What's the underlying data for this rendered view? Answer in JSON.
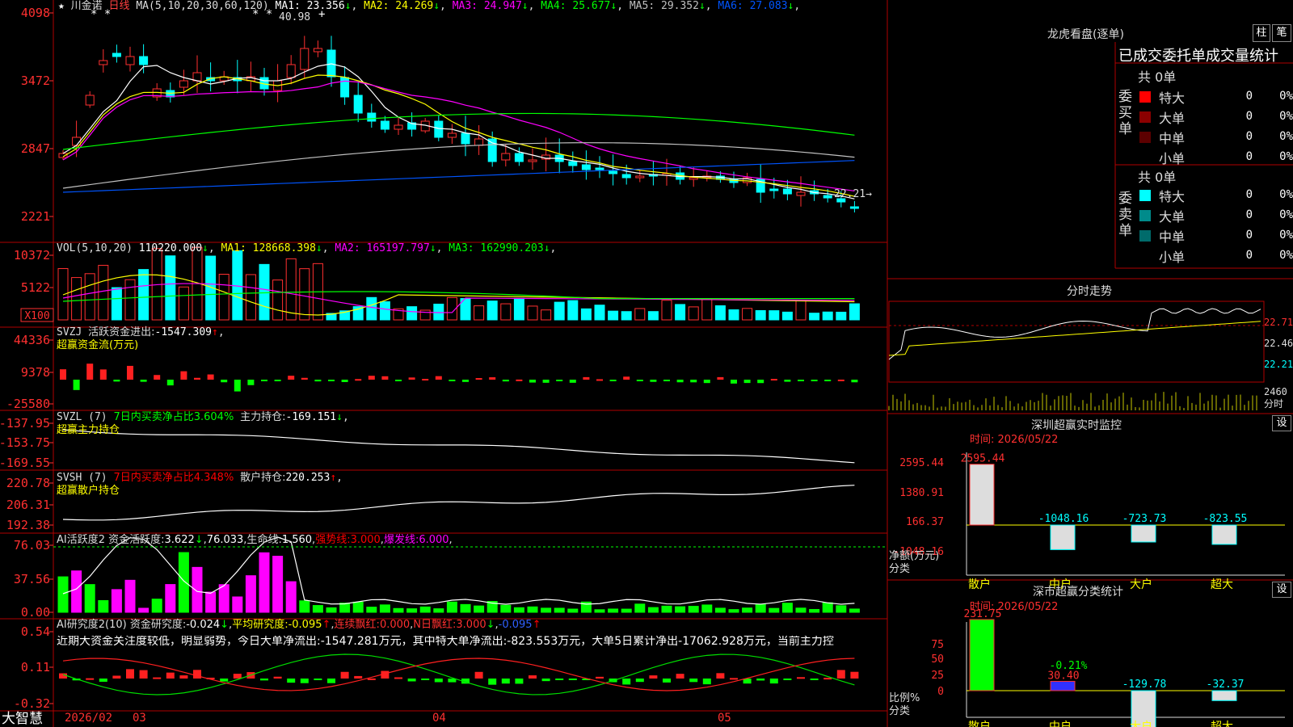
{
  "stock": {
    "name": "川金诺",
    "period": "日线",
    "ma_label": "MA(5,10,20,30,60,120)",
    "ma": [
      {
        "label": "MA1:",
        "value": "23.356",
        "arrow": "↓",
        "color": "#ffffff"
      },
      {
        "label": "MA2:",
        "value": "24.269",
        "arrow": "↓",
        "color": "#ffff00"
      },
      {
        "label": "MA3:",
        "value": "24.947",
        "arrow": "↓",
        "color": "#ff00ff"
      },
      {
        "label": "MA4:",
        "value": "25.677",
        "arrow": "↓",
        "color": "#00ff00"
      },
      {
        "label": "MA5:",
        "value": "29.352",
        "arrow": "↓",
        "color": "#c0c0c0"
      },
      {
        "label": "MA6:",
        "value": "27.083",
        "arrow": "↓",
        "color": "#0055ff"
      }
    ],
    "high_label": "40.98",
    "low_label": "22.21",
    "y_ticks": [
      "4098",
      "3472",
      "2847",
      "2221"
    ]
  },
  "vol": {
    "title": "VOL(5,10,20)",
    "value": "110220.000",
    "arrow": "↓",
    "ma": [
      {
        "label": "MA1:",
        "value": "128668.398",
        "arrow": "↓",
        "color": "#ffff00"
      },
      {
        "label": "MA2:",
        "value": "165197.797",
        "arrow": "↓",
        "color": "#ff00ff"
      },
      {
        "label": "MA3:",
        "value": "162990.203",
        "arrow": "↓",
        "color": "#00ff00"
      }
    ],
    "y_ticks": [
      "10372",
      "5122"
    ],
    "unit": "X100"
  },
  "svzj": {
    "title": "SVZJ",
    "label": "活跃资金进出:",
    "value": "-1547.309",
    "arrow": "↑",
    "comma": ",",
    "sub": "超赢资金流(万元)",
    "y_ticks": [
      "44336",
      "9378",
      "-25580"
    ]
  },
  "svzl": {
    "title": "SVZL (7)",
    "ratio": "7日内买卖净占比3.604%",
    "label": "主力持仓:",
    "value": "-169.151",
    "arrow": "↓",
    "comma": ",",
    "sub": "超赢主力持仓",
    "y_ticks": [
      "-137.95",
      "-153.75",
      "-169.55"
    ]
  },
  "svsh": {
    "title": "SVSH (7)",
    "ratio": "7日内买卖净占比4.348%",
    "label": "散户持仓:",
    "value": "220.253",
    "arrow": "↑",
    "comma": ",",
    "sub": "超赢散户持仓",
    "y_ticks": [
      "220.78",
      "206.31",
      "192.38"
    ]
  },
  "ai1": {
    "title": "AI活跃度2",
    "label": "资金活跃度:",
    "value": "3.622",
    "arrow": "↓",
    "comma": ",",
    "v2": "76.033",
    "lbl3": "生命线:",
    "v3": "1.560",
    "comma2": ",",
    "lbl4": "强势线:",
    "v4": "3.000",
    "lbl5": "爆发线:",
    "v5": "6.000",
    "y_ticks": [
      "76.03",
      "37.56",
      "0.00"
    ]
  },
  "ai2": {
    "title": "AI研究度2(10)",
    "lbl1": "资金研究度:",
    "v1": "-0.024",
    "a1": "↓",
    "comma": ",",
    "lbl2": "平均研究度:",
    "v2": "-0.095",
    "a2": "↑",
    "lbl3": "连续飘红:",
    "v3": "0.000",
    "lbl4": "N日飘红:",
    "v4": "3.000",
    "a4": "↓",
    "v5": "-0.095",
    "a5": "↑",
    "comment": "近期大资金关注度较低，明显弱势，今日大单净流出:-1547.281万元，其中特大单净流出:-823.553万元，大单5日累计净出-17062.928万元，当前主力控",
    "y_ticks": [
      "0.54",
      "0.11",
      "-0.32"
    ]
  },
  "footer": {
    "app": "大智慧",
    "dates": [
      "2026/02",
      "03",
      "04",
      "05"
    ]
  },
  "right": {
    "title": "龙虎看盘(逐单)",
    "btn1": "柱",
    "btn2": "笔",
    "header": "已成交委托单成交量统计",
    "buy": {
      "side": "委买单",
      "total": "共 0单",
      "rows": [
        {
          "label": "特大",
          "vol": "0",
          "pct": "0%",
          "color": "#ff0000"
        },
        {
          "label": "大单",
          "vol": "0",
          "pct": "0%",
          "color": "#8b0000"
        },
        {
          "label": "中单",
          "vol": "0",
          "pct": "0%",
          "color": "#5c0000"
        },
        {
          "label": "小单",
          "vol": "0",
          "pct": "0%",
          "color": "#000000"
        }
      ]
    },
    "sell": {
      "side": "委卖单",
      "total": "共 0单",
      "rows": [
        {
          "label": "特大",
          "vol": "0",
          "pct": "0%",
          "color": "#00ffff"
        },
        {
          "label": "大单",
          "vol": "0",
          "pct": "0%",
          "color": "#008b8b"
        },
        {
          "label": "中单",
          "vol": "0",
          "pct": "0%",
          "color": "#006b6b"
        },
        {
          "label": "小单",
          "vol": "0",
          "pct": "0%",
          "color": "#000000"
        }
      ]
    },
    "intraday": {
      "title": "分时走势",
      "prices": [
        "22.71",
        "22.46",
        "22.21"
      ],
      "vol_tick": "2460",
      "unit": "分时"
    },
    "monitor": {
      "title": "深圳超赢实时监控",
      "set": "设",
      "time": "时间: 2026/05/22",
      "ticks": [
        "2595.44",
        "1380.91",
        "166.37",
        "-1048.16"
      ],
      "categories": [
        "散户",
        "中户",
        "大户",
        "超大"
      ],
      "values": [
        2595.44,
        -1048.16,
        -723.73,
        -823.55
      ],
      "value_labels": [
        "2595.44",
        "-1048.16",
        "-723.73",
        "-823.55"
      ],
      "ylabel": "净额(万元)",
      "xlabel": "分类"
    },
    "stats": {
      "title": "深市超赢分类统计",
      "set": "设",
      "time": "时间: 2026/05/22",
      "ticks": [
        "75",
        "50",
        "25",
        "0"
      ],
      "categories": [
        "散户",
        "中户",
        "大户",
        "超大"
      ],
      "values": [
        231.75,
        30.4,
        -129.78,
        -32.37
      ],
      "value_labels": [
        "231.75",
        "30.40",
        "-129.78",
        "-32.37"
      ],
      "small_label": "-0.21%",
      "ylabel": "比例%",
      "xlabel": "分类"
    }
  }
}
